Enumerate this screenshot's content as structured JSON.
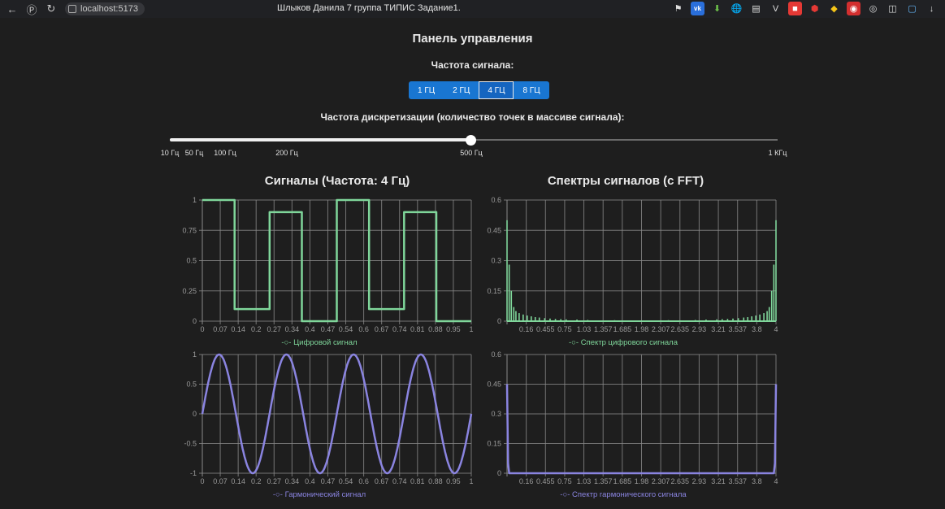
{
  "browser": {
    "url": "localhost:5173",
    "tab_title": "Шлыков Данила 7 группа ТИПИС Задание1."
  },
  "panel": {
    "title": "Панель управления",
    "freq_label": "Частота сигнала:",
    "freq_buttons": [
      "1 ГЦ",
      "2 ГЦ",
      "4 ГЦ",
      "8 ГЦ"
    ],
    "freq_selected": "4 ГЦ",
    "disc_label": "Частота дискретизации (количество точек в массиве сигнала):",
    "slider_marks": [
      "10 Гц",
      "50 Гц",
      "100 Гц",
      "200 Гц",
      "500 Гц",
      "1 КГц"
    ],
    "slider_value": "500 Гц"
  },
  "sections": {
    "signals_title": "Сигналы (Частота: 4 Гц)",
    "spectra_title": "Спектры сигналов (с FFT)"
  },
  "colors": {
    "digital": "#7fd69a",
    "harmonic": "#8a84e0",
    "grid": "#8a8a8a",
    "button": "#1976d2"
  },
  "chart_data": [
    {
      "type": "line",
      "series": [
        {
          "name": "Цифровой сигнал",
          "x": [
            0,
            0.12,
            0.12,
            0.25,
            0.25,
            0.37,
            0.37,
            0.5,
            0.5,
            0.62,
            0.62,
            0.75,
            0.75,
            0.87,
            0.87,
            1
          ],
          "values": [
            1,
            1,
            0.1,
            0.1,
            0.9,
            0.9,
            0,
            0,
            1,
            1,
            0.1,
            0.1,
            0.9,
            0.9,
            0,
            0
          ]
        }
      ],
      "x_ticks": [
        "0",
        "0.07",
        "0.14",
        "0.2",
        "0.27",
        "0.34",
        "0.4",
        "0.47",
        "0.54",
        "0.6",
        "0.67",
        "0.74",
        "0.81",
        "0.88",
        "0.95",
        "1"
      ],
      "y_ticks": [
        "0",
        "0.25",
        "0.5",
        "0.75",
        "1"
      ],
      "ylim": [
        0,
        1
      ],
      "xlim": [
        0,
        1
      ]
    },
    {
      "type": "line",
      "series": [
        {
          "name": "Спектр цифрового сигнала",
          "x": [
            0.0,
            0.008,
            0.016,
            0.025,
            0.033,
            0.045,
            0.06,
            0.075,
            0.09,
            0.105,
            0.12,
            0.14,
            0.16,
            0.18,
            0.2,
            0.22,
            0.26,
            0.3,
            0.4,
            0.5,
            0.6,
            0.7,
            0.74,
            0.78,
            0.8,
            0.82,
            0.84,
            0.86,
            0.88,
            0.895,
            0.91,
            0.925,
            0.94,
            0.955,
            0.967,
            0.975,
            0.984,
            0.992,
            1.0
          ],
          "values": [
            0.5,
            0.28,
            0.15,
            0.07,
            0.05,
            0.04,
            0.033,
            0.028,
            0.024,
            0.02,
            0.018,
            0.015,
            0.013,
            0.011,
            0.01,
            0.009,
            0.008,
            0.006,
            0.005,
            0.004,
            0.005,
            0.006,
            0.008,
            0.009,
            0.01,
            0.011,
            0.013,
            0.015,
            0.018,
            0.02,
            0.024,
            0.028,
            0.033,
            0.04,
            0.05,
            0.07,
            0.15,
            0.28,
            0.5
          ]
        }
      ],
      "x_ticks": [
        "0.16",
        "0.455",
        "0.75",
        "1.03",
        "1.357",
        "1.685",
        "1.98",
        "2.307",
        "2.635",
        "2.93",
        "3.21",
        "3.537",
        "3.8",
        "4"
      ],
      "y_ticks": [
        "0",
        "0.15",
        "0.3",
        "0.45",
        "0.6"
      ],
      "ylim": [
        0,
        0.6
      ]
    },
    {
      "type": "line",
      "series": [
        {
          "name": "Гармонический сигнал",
          "function": "sin(2*pi*4*t)",
          "y_min": -1,
          "y_max": 1
        }
      ],
      "x_ticks": [
        "0",
        "0.07",
        "0.14",
        "0.2",
        "0.27",
        "0.34",
        "0.4",
        "0.47",
        "0.54",
        "0.6",
        "0.67",
        "0.74",
        "0.81",
        "0.88",
        "0.95",
        "1"
      ],
      "y_ticks": [
        "-1",
        "-0.5",
        "0",
        "0.5",
        "1"
      ],
      "ylim": [
        -1,
        1
      ],
      "xlim": [
        0,
        1
      ]
    },
    {
      "type": "line",
      "series": [
        {
          "name": "Спектр гармонического сигнала",
          "x": [
            0,
            0.004,
            0.008,
            0.5,
            0.992,
            0.996,
            1.0
          ],
          "values": [
            0.45,
            0.05,
            0,
            0,
            0,
            0.05,
            0.45
          ]
        }
      ],
      "x_ticks": [
        "0.16",
        "0.455",
        "0.75",
        "1.03",
        "1.357",
        "1.685",
        "1.98",
        "2.307",
        "2.635",
        "2.93",
        "3.21",
        "3.537",
        "3.8",
        "4"
      ],
      "y_ticks": [
        "0",
        "0.15",
        "0.3",
        "0.45",
        "0.6"
      ],
      "ylim": [
        0,
        0.6
      ]
    }
  ]
}
